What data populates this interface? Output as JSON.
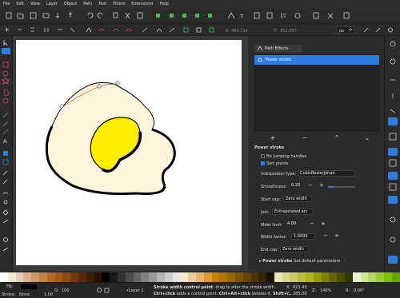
{
  "menu": [
    "File",
    "Edit",
    "View",
    "Layer",
    "Object",
    "Path",
    "Text",
    "Filters",
    "Extensions",
    "Help"
  ],
  "coords": {
    "x_label": "X:",
    "x_val": "480.714",
    "y_label": "Y:",
    "y_val": "352.857",
    "unit": "px"
  },
  "panel": {
    "tab": "Path Effects",
    "list_item": "Power stroke",
    "section_title": "Power stroke",
    "no_jumping": "No jumping handles",
    "sort_points": "Sort points",
    "interp_label": "Interpolator type:",
    "interp_val": "CubicBezierJohan",
    "smooth_label": "Smoothness:",
    "smooth_val": "0.20",
    "smooth_frac": 0.2,
    "start_label": "Start cap:",
    "start_val": "Zero width",
    "join_label": "Join:",
    "join_val": "Extrapolated arc",
    "miter_label": "Miter limit:",
    "miter_val": "4.00",
    "width_label": "Width factor:",
    "width_val": "1.0000",
    "end_label": "End cap:",
    "end_val": "Zero width",
    "footer_title": "Power stroke",
    "footer_text": "Set default parameters"
  },
  "status": {
    "fill_label": "Fill:",
    "stroke_label": "Stroke:",
    "stroke_val": "None",
    "stroke_w": "1.00",
    "o_label": "O:",
    "o_val": "100",
    "layer": "•Layer 1",
    "msg_bold": "Stroke width control point",
    "msg_rest": ": drag to alter the stroke width.",
    "msg2_bold1": "Ctrl+click",
    "msg2_rest1": " adds a control point, ",
    "msg2_bold2": "Ctrl+Alt+click",
    "msg2_rest2": " deletes it, ",
    "msg2_bold3": "Shift+...",
    "x_label": "X:",
    "x_val": "621.43",
    "y_label": "Y:",
    "y_val": "285.00",
    "z_label": "Z:",
    "z_val": "140%",
    "r_label": "R:",
    "r_val": "0.00°"
  },
  "icons": {
    "toolbar": [
      "new-doc-icon",
      "open-icon",
      "save-icon",
      "print-icon",
      "import-icon",
      "export-icon",
      "undo-icon",
      "redo-icon",
      "copy-icon",
      "cut-icon",
      "paste-icon",
      "zoom-icon",
      "zoom-drawing-icon",
      "zoom-page-icon",
      "duplicate-icon",
      "clone-icon",
      "unlink-icon",
      "group-icon",
      "ungroup-icon",
      "fill-stroke-icon",
      "text-icon",
      "layers-icon",
      "xml-icon",
      "align-icon",
      "prefs-icon"
    ],
    "tools": [
      "selector-icon",
      "node-icon",
      "rect-icon",
      "circle-icon",
      "star-icon",
      "spiral-icon",
      "pencil-icon",
      "pen-icon",
      "calligraphy-icon",
      "text-tool-icon",
      "gradient-icon",
      "mesh-icon",
      "dropper-icon",
      "paint-bucket-icon",
      "tweak-icon",
      "spray-icon",
      "eraser-icon",
      "connector-icon",
      "zoom-tool-icon",
      "measure-icon"
    ]
  },
  "colors": {
    "accent": "#2f7de1",
    "egg_white": "#fff5dc",
    "yolk": "#ffee00"
  }
}
